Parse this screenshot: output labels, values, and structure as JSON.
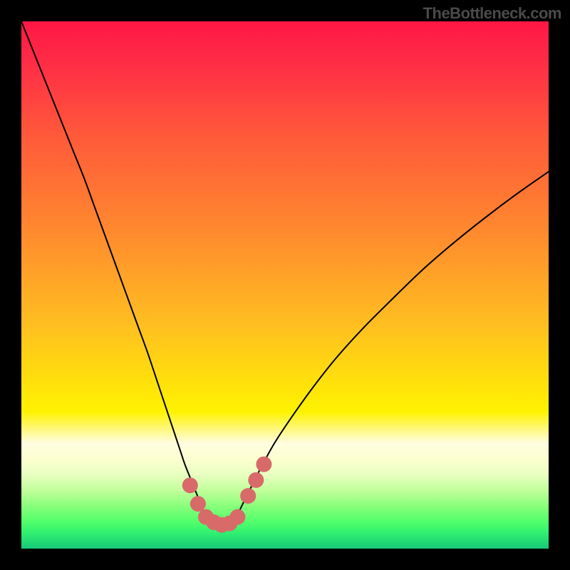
{
  "watermark": "TheBottleneck.com",
  "chart_data": {
    "type": "line",
    "title": "",
    "xlabel": "",
    "ylabel": "",
    "xlim": [
      0,
      100
    ],
    "ylim": [
      0,
      100
    ],
    "background_gradient": [
      {
        "pos": 0.0,
        "color": "#ff1744"
      },
      {
        "pos": 0.07,
        "color": "#ff2a46"
      },
      {
        "pos": 0.22,
        "color": "#ff5a3a"
      },
      {
        "pos": 0.4,
        "color": "#ff8a2e"
      },
      {
        "pos": 0.58,
        "color": "#ffc020"
      },
      {
        "pos": 0.74,
        "color": "#fff200"
      },
      {
        "pos": 0.8,
        "color": "#fffde0"
      },
      {
        "pos": 0.83,
        "color": "#fdffd0"
      },
      {
        "pos": 0.86,
        "color": "#e8ffc0"
      },
      {
        "pos": 0.89,
        "color": "#c0ff9a"
      },
      {
        "pos": 0.92,
        "color": "#88ff7a"
      },
      {
        "pos": 0.95,
        "color": "#50ff6a"
      },
      {
        "pos": 0.97,
        "color": "#30f070"
      },
      {
        "pos": 1.0,
        "color": "#18c878"
      }
    ],
    "series": [
      {
        "name": "bottleneck-curve",
        "x": [
          0,
          2,
          4,
          6,
          8,
          10,
          12,
          14,
          16,
          18,
          20,
          22,
          24,
          26,
          28,
          30,
          31,
          32,
          33,
          34,
          35,
          36,
          37,
          38,
          39,
          40,
          41,
          42,
          43,
          45,
          48,
          52,
          56,
          60,
          65,
          70,
          76,
          82,
          88,
          94,
          100
        ],
        "y": [
          100,
          95,
          90,
          85,
          80,
          75,
          70,
          64.5,
          59,
          53.5,
          48,
          42.5,
          37,
          31,
          25,
          19,
          16,
          13.5,
          11,
          8.5,
          6,
          5,
          4.3,
          4,
          4.3,
          5,
          6.5,
          8.5,
          10.5,
          14.5,
          20,
          26,
          31.5,
          36.5,
          42,
          47,
          52.8,
          58,
          62.8,
          67.3,
          71.5
        ]
      }
    ],
    "markers": {
      "name": "recommended-range",
      "color": "#d86a6a",
      "x": [
        32.0,
        33.5,
        35.0,
        36.5,
        38.0,
        39.5,
        41.0,
        43.0,
        44.5,
        46.0
      ],
      "y": [
        12.0,
        8.5,
        6.0,
        5.0,
        4.5,
        4.8,
        6.0,
        10.0,
        13.0,
        16.0
      ]
    }
  }
}
